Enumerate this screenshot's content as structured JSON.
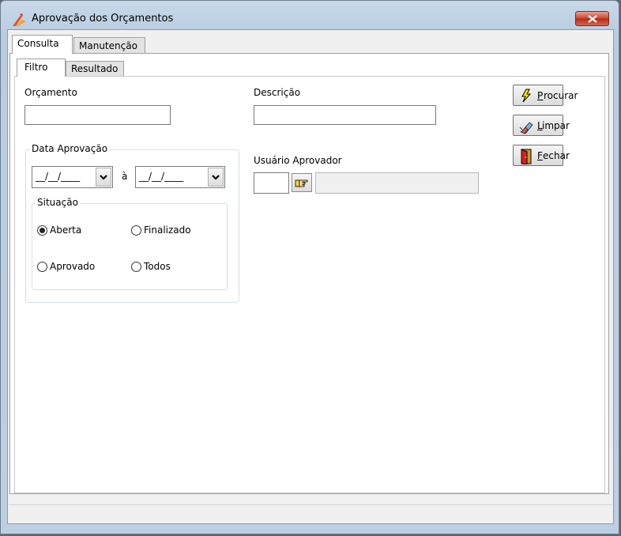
{
  "window": {
    "title": "Aprovação dos Orçamentos"
  },
  "tabs_outer": [
    {
      "label": "Consulta"
    },
    {
      "label": "Manutenção"
    }
  ],
  "tabs_inner": [
    {
      "label": "Filtro"
    },
    {
      "label": "Resultado"
    }
  ],
  "filter": {
    "orcamento_label": "Orçamento",
    "orcamento_value": "",
    "descricao_label": "Descrição",
    "descricao_value": "",
    "data_aprovacao_label": "Data Aprovação",
    "date_from": "__/__/____",
    "date_to": "__/__/____",
    "date_separator": "à",
    "situacao_label": "Situação",
    "situacao_options": [
      {
        "label": "Aberta",
        "checked": true
      },
      {
        "label": "Finalizado",
        "checked": false
      },
      {
        "label": "Aprovado",
        "checked": false
      },
      {
        "label": "Todos",
        "checked": false
      }
    ],
    "usuario_label": "Usuário Aprovador",
    "usuario_code": "",
    "usuario_name": ""
  },
  "buttons": {
    "procurar": {
      "label_first": "P",
      "label_rest": "rocurar",
      "icon": "lightning-icon"
    },
    "limpar": {
      "label_first": "L",
      "label_rest": "impar",
      "icon": "eraser-icon"
    },
    "fechar": {
      "label_first": "F",
      "label_rest": "echar",
      "icon": "door-exit-icon"
    }
  },
  "status_bar": {
    "text": ""
  }
}
